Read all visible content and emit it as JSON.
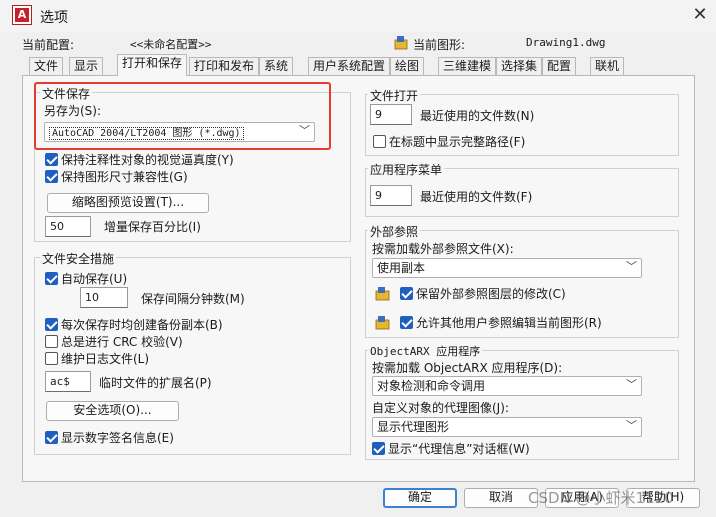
{
  "window": {
    "title": "选项"
  },
  "header": {
    "profile_label": "当前配置:",
    "profile_value": "<<未命名配置>>",
    "drawing_label": "当前图形:",
    "drawing_value": "Drawing1.dwg"
  },
  "tabs": [
    "文件",
    "显示",
    "打开和保存",
    "打印和发布",
    "系统",
    "用户系统配置",
    "绘图",
    "三维建模",
    "选择集",
    "配置",
    "联机"
  ],
  "active_tab": "打开和保存",
  "file_save": {
    "title": "文件保存",
    "save_as_label": "另存为(S):",
    "save_as_value": "AutoCAD 2004/LT2004 图形 (*.dwg)",
    "annotative_label": "保持注释性对象的视觉逼真度(Y)",
    "annotative_checked": true,
    "drawing_size_label": "保持图形尺寸兼容性(G)",
    "drawing_size_checked": true,
    "thumbnail_button": "缩略图预览设置(T)...",
    "incremental_value": "50",
    "incremental_label": "增量保存百分比(I)"
  },
  "safety": {
    "title": "文件安全措施",
    "autosave_label": "自动保存(U)",
    "autosave_checked": true,
    "minutes_value": "10",
    "minutes_label": "保存间隔分钟数(M)",
    "backup_label": "每次保存时均创建备份副本(B)",
    "backup_checked": true,
    "crc_label": "总是进行 CRC 校验(V)",
    "crc_checked": false,
    "log_label": "维护日志文件(L)",
    "log_checked": false,
    "ext_value": "ac$",
    "ext_label": "临时文件的扩展名(P)",
    "security_button": "安全选项(O)...",
    "digital_sig_label": "显示数字签名信息(E)",
    "digital_sig_checked": true
  },
  "file_open": {
    "title": "文件打开",
    "recent_value": "9",
    "recent_label": "最近使用的文件数(N)",
    "full_path_label": "在标题中显示完整路径(F)",
    "full_path_checked": false
  },
  "app_menu": {
    "title": "应用程序菜单",
    "recent_value": "9",
    "recent_label": "最近使用的文件数(F)"
  },
  "xref": {
    "title": "外部参照",
    "demand_label": "按需加载外部参照文件(X):",
    "demand_value": "使用副本",
    "retain_label": "保留外部参照图层的修改(C)",
    "retain_checked": true,
    "allow_edit_label": "允许其他用户参照编辑当前图形(R)",
    "allow_edit_checked": true
  },
  "objectarx": {
    "title": "ObjectARX 应用程序",
    "demand_label": "按需加载 ObjectARX 应用程序(D):",
    "demand_value": "对象检测和命令调用",
    "proxy_label": "自定义对象的代理图像(J):",
    "proxy_value": "显示代理图形",
    "proxy_info_label": "显示“代理信息”对话框(W)",
    "proxy_info_checked": true
  },
  "footer": {
    "ok": "确定",
    "cancel": "取消",
    "apply": "应用(A)",
    "help": "帮助(H)"
  },
  "watermark": "CSDN @小虾米1120",
  "colors": {
    "highlight_box": "#e53a2e",
    "checkbox": "#1f5fbf",
    "default_button_border": "#3f7fd0"
  }
}
